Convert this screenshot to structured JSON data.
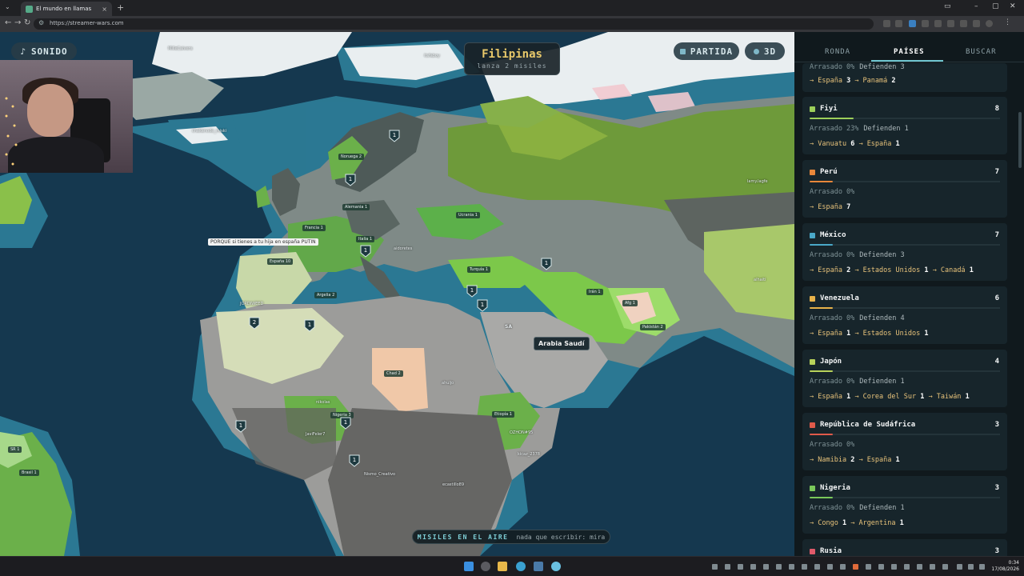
{
  "browser": {
    "tab_title": "El mundo en llamas",
    "url": "https://streamer-wars.com",
    "tab_close": "×",
    "new_tab": "+"
  },
  "game": {
    "sound_label": "SONIDO",
    "turn": {
      "country": "Filipinas",
      "action": "lanza 2 misiles"
    },
    "partida_label": "PARTIDA",
    "view3d_label": "3D",
    "tooltip": "Arabia Saudí",
    "chat_bubble": "PORQUE si tienes a tu hija en españa PUTIN",
    "missiles_title": "MISILES EN EL AIRE",
    "missiles_msg": "nada que escribir: mira",
    "map_labels": {
      "lbl1": "MilleCalvera",
      "lbl2": "itsfaboy",
      "lbl3": "chakanode_miski",
      "lbl4": "lamy.lagfe",
      "lbl5": "aidoretes",
      "lbl6": "OZHON#95",
      "lbl7": "Nismo_Creativo",
      "lbl8": "ecastillo89",
      "lbl9": "nikolas",
      "lbl10": "JORDIWEED",
      "lbl11": "kicaz_2378",
      "lbl12": "alhaiti",
      "lbl13": "ahuljo",
      "lbl14": "JaviFeler7",
      "lbl15": "SA"
    },
    "chips": {
      "c1": "Francia 1",
      "c2": "Alemania 1",
      "c3": "Noruega 2",
      "c4": "Italia 1",
      "c5": "Argelia 2",
      "c6": "Turquía 1",
      "c7": "Irán 1",
      "c8": "Chad 2",
      "c9": "Nigeria 3",
      "c10": "Etiopía 1",
      "c11": "Afg 1",
      "c12": "Ucrania 1",
      "c13": "Pakistán 2",
      "c14": "SR 1",
      "c15": "Brasil 1",
      "c16": "España 10"
    },
    "markers": [
      "1",
      "1",
      "1",
      "1",
      "1",
      "2",
      "1",
      "1",
      "1",
      "1",
      "1"
    ]
  },
  "panel": {
    "tabs": [
      "RONDA",
      "PAÍSES",
      "BUSCAR"
    ],
    "active_tab": "PAÍSES",
    "partial_card": {
      "status": "Arrasado 0%",
      "defend": "Defienden 3",
      "links_text": [
        "→ España ",
        "3",
        " → Panamá ",
        "2"
      ]
    },
    "countries": [
      {
        "name": "Fiyi",
        "score": "8",
        "color": "#9ccf5a",
        "razed_pct": 23,
        "status": "Arrasado 23%",
        "defend": "Defienden 1",
        "links": [
          [
            "Vanuatu",
            "6"
          ],
          [
            "España",
            "1"
          ]
        ]
      },
      {
        "name": "Perú",
        "score": "7",
        "color": "#e8873a",
        "razed_pct": 0,
        "status": "Arrasado 0%",
        "defend": "",
        "links": [
          [
            "España",
            "7"
          ]
        ]
      },
      {
        "name": "México",
        "score": "7",
        "color": "#4aa8c8",
        "razed_pct": 0,
        "status": "Arrasado 0%",
        "defend": "Defienden 3",
        "links": [
          [
            "España",
            "2"
          ],
          [
            "Estados Unidos",
            "1"
          ],
          [
            "Canadá",
            "1"
          ]
        ]
      },
      {
        "name": "Venezuela",
        "score": "6",
        "color": "#e8b24a",
        "razed_pct": 0,
        "status": "Arrasado 0%",
        "defend": "Defienden 4",
        "links": [
          [
            "España",
            "1"
          ],
          [
            "Estados Unidos",
            "1"
          ]
        ]
      },
      {
        "name": "Japón",
        "score": "4",
        "color": "#b8d25a",
        "razed_pct": 0,
        "status": "Arrasado 0%",
        "defend": "Defienden 1",
        "links": [
          [
            "España",
            "1"
          ],
          [
            "Corea del Sur",
            "1"
          ],
          [
            "Taiwán",
            "1"
          ]
        ]
      },
      {
        "name": "República de Sudáfrica",
        "score": "3",
        "color": "#e05a4a",
        "razed_pct": 0,
        "status": "Arrasado 0%",
        "defend": "",
        "links": [
          [
            "Namibia",
            "2"
          ],
          [
            "España",
            "1"
          ]
        ]
      },
      {
        "name": "Nigeria",
        "score": "3",
        "color": "#7ac85a",
        "razed_pct": 0,
        "status": "Arrasado 0%",
        "defend": "Defienden 1",
        "links": [
          [
            "Congo",
            "1"
          ],
          [
            "Argentina",
            "1"
          ]
        ]
      },
      {
        "name": "Rusia",
        "score": "3",
        "color": "#e05a6a",
        "razed_pct": 0,
        "status": "",
        "defend": "",
        "links": []
      }
    ]
  },
  "taskbar": {
    "time": "0:34",
    "date": "17/08/2026"
  }
}
